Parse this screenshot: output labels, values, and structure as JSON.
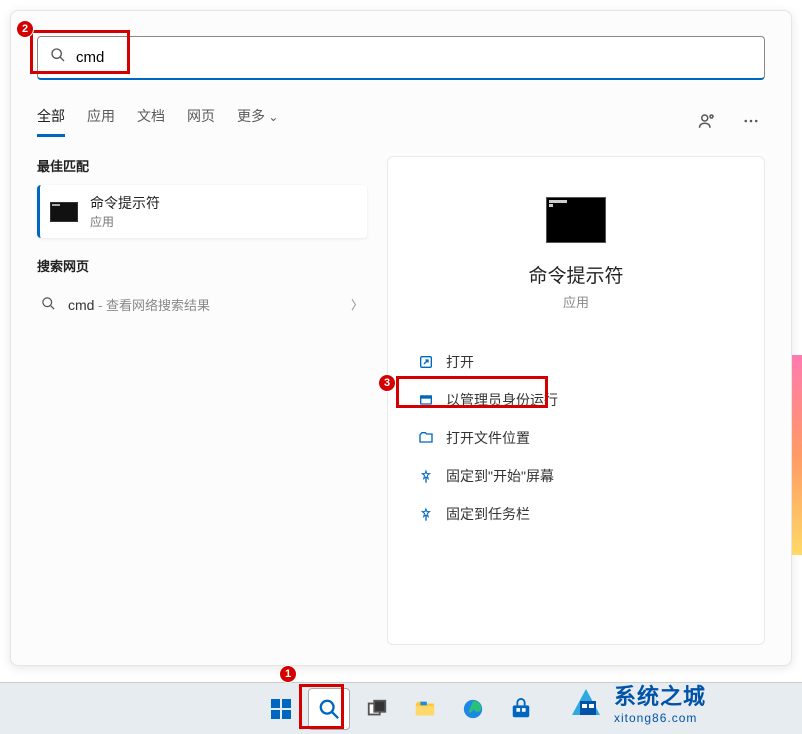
{
  "search": {
    "value": "cmd"
  },
  "tabs": {
    "all": "全部",
    "apps": "应用",
    "docs": "文档",
    "web": "网页",
    "more": "更多"
  },
  "left": {
    "best_match_h": "最佳匹配",
    "best_title": "命令提示符",
    "best_sub": "应用",
    "web_h": "搜索网页",
    "web_query": "cmd",
    "web_suffix": " - 查看网络搜索结果"
  },
  "pane": {
    "title": "命令提示符",
    "sub": "应用",
    "actions": {
      "open": "打开",
      "run_admin": "以管理员身份运行",
      "open_loc": "打开文件位置",
      "pin_start": "固定到\"开始\"屏幕",
      "pin_task": "固定到任务栏"
    }
  },
  "callouts": {
    "c1": "1",
    "c2": "2",
    "c3": "3"
  },
  "watermark": {
    "line1": "系统之城",
    "line2": "xitong86.com"
  }
}
